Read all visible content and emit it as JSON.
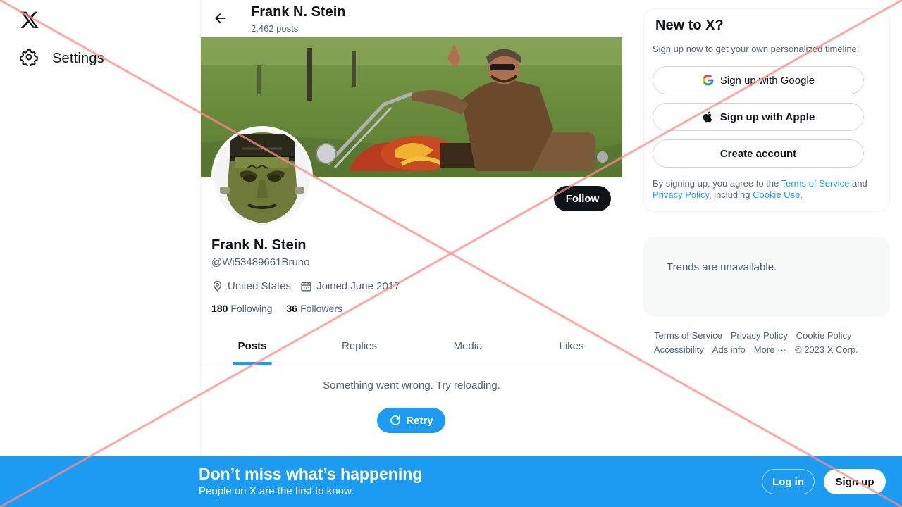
{
  "nav": {
    "logo_icon": "x-logo-icon",
    "settings_label": "Settings",
    "settings_icon": "gear-icon"
  },
  "header": {
    "back_icon": "arrow-left-icon",
    "name": "Frank N. Stein",
    "posts_count": "2,462 posts"
  },
  "profile": {
    "name": "Frank N. Stein",
    "handle": "@Wi53489661Bruno",
    "location": "United States",
    "joined": "Joined June 2017",
    "following_count": "180",
    "following_label": "Following",
    "followers_count": "36",
    "followers_label": "Followers",
    "follow_label": "Follow"
  },
  "tabs": [
    {
      "label": "Posts",
      "active": true
    },
    {
      "label": "Replies",
      "active": false
    },
    {
      "label": "Media",
      "active": false
    },
    {
      "label": "Likes",
      "active": false
    }
  ],
  "timeline": {
    "error_message": "Something went wrong. Try reloading.",
    "retry_label": "Retry"
  },
  "signup": {
    "title": "New to X?",
    "subtitle": "Sign up now to get your own personalized timeline!",
    "google_label": "Sign up with Google",
    "apple_label": "Sign up with Apple",
    "create_label": "Create account",
    "terms_prefix": "By signing up, you agree to the ",
    "terms_link": "Terms of Service",
    "terms_and": " and ",
    "privacy_link": "Privacy Policy",
    "terms_including": ", including ",
    "cookie_link": "Cookie Use",
    "terms_end": "."
  },
  "trends": {
    "message": "Trends are unavailable."
  },
  "footer": {
    "terms": "Terms of Service",
    "privacy": "Privacy Policy",
    "cookie": "Cookie Policy",
    "accessibility": "Accessibility",
    "ads": "Ads info",
    "more": "More ···",
    "copyright": "© 2023 X Corp."
  },
  "bottom_bar": {
    "title": "Don’t miss what’s happening",
    "subtitle": "People on X are the first to know.",
    "login_label": "Log in",
    "signup_label": "Sign up"
  },
  "colors": {
    "accent": "#1d9bf0",
    "text_primary": "#0f1419",
    "text_secondary": "#536471",
    "overlay_red": "#ff8a8a"
  }
}
